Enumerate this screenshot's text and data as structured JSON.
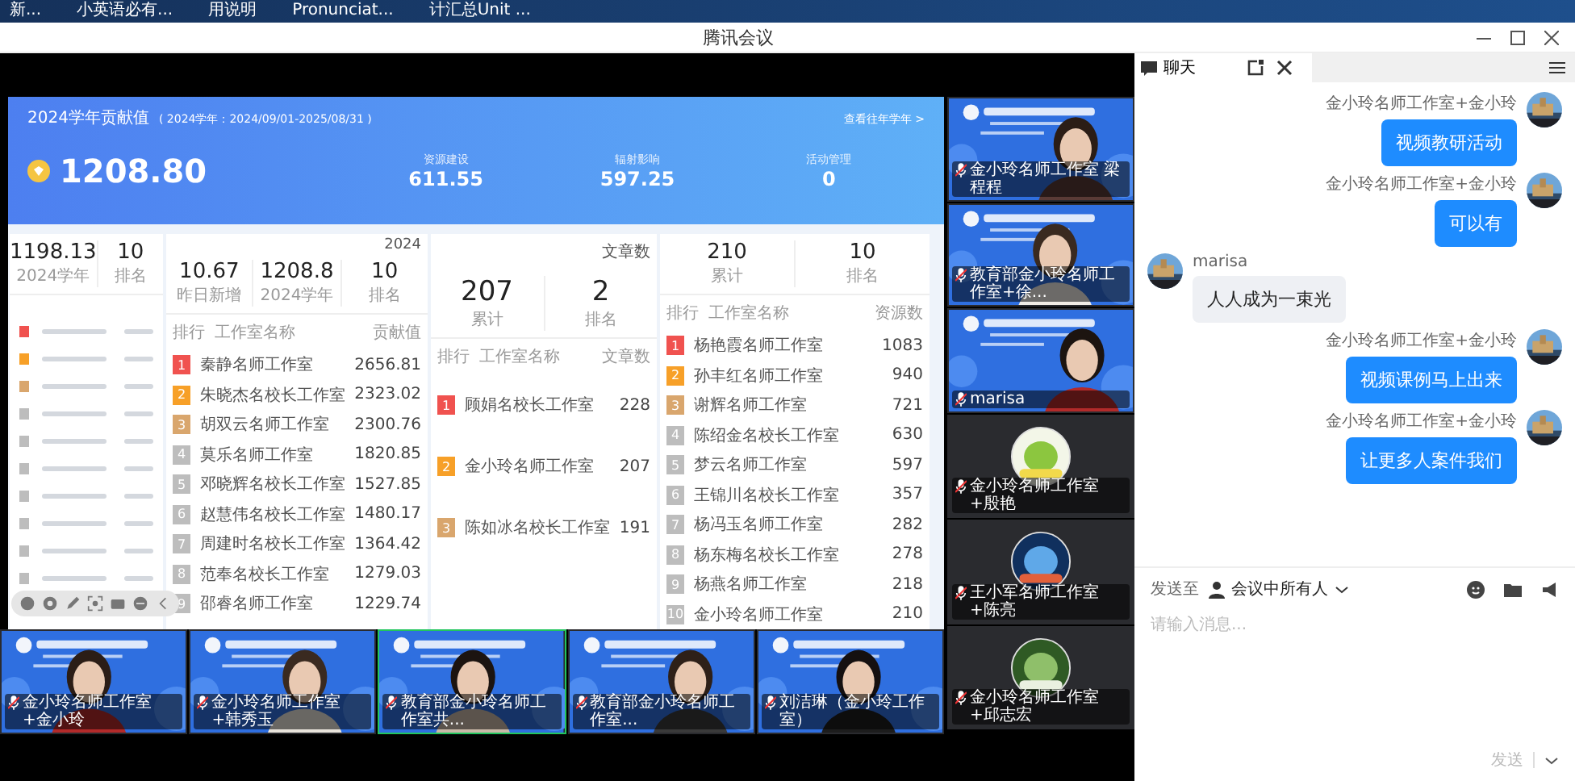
{
  "taskbar": {
    "items": [
      "新...",
      "小英语必有...",
      "用说明",
      "Pronunciat...",
      "计汇总Unit ..."
    ]
  },
  "window": {
    "title": "腾讯会议"
  },
  "share": {
    "header": {
      "title": "2024学年贡献值",
      "period": "( 2024学年：2024/09/01-2025/08/31 )",
      "link": "查看往年学年 >",
      "total": "1208.80",
      "metrics": [
        {
          "label": "资源建设",
          "value": "611.55"
        },
        {
          "label": "辐射影响",
          "value": "597.25"
        },
        {
          "label": "活动管理",
          "value": "0"
        }
      ]
    },
    "card1": {
      "stats": [
        {
          "value": "1198.13",
          "label": "2024学年"
        },
        {
          "value": "10",
          "label": "排名"
        }
      ],
      "rows": [
        {
          "color": "#f0524f"
        },
        {
          "color": "#f7a028"
        },
        {
          "color": "#d9a66d"
        },
        {
          "color": "#bdbdbd"
        },
        {
          "color": "#bdbdbd"
        },
        {
          "color": "#bdbdbd"
        },
        {
          "color": "#bdbdbd"
        },
        {
          "color": "#bdbdbd"
        },
        {
          "color": "#bdbdbd"
        },
        {
          "color": "#bdbdbd"
        }
      ]
    },
    "card2": {
      "year": "2024",
      "stats": [
        {
          "value": "10.67",
          "label": "昨日新增"
        },
        {
          "value": "1208.8",
          "label": "2024学年"
        },
        {
          "value": "10",
          "label": "排名"
        }
      ],
      "columns": [
        "排行",
        "工作室名称",
        "贡献值"
      ],
      "rows": [
        {
          "rank": "1",
          "color": "#f0524f",
          "name": "秦静名师工作室",
          "value": "2656.81"
        },
        {
          "rank": "2",
          "color": "#f7a028",
          "name": "朱晓杰名校长工作室",
          "value": "2323.02"
        },
        {
          "rank": "3",
          "color": "#d9a66d",
          "name": "胡双云名师工作室",
          "value": "2300.76"
        },
        {
          "rank": "4",
          "color": "#bdbdbd",
          "name": "莫乐名师工作室",
          "value": "1820.85"
        },
        {
          "rank": "5",
          "color": "#bdbdbd",
          "name": "邓晓辉名校长工作室",
          "value": "1527.85"
        },
        {
          "rank": "6",
          "color": "#bdbdbd",
          "name": "赵慧伟名校长工作室",
          "value": "1480.17"
        },
        {
          "rank": "7",
          "color": "#bdbdbd",
          "name": "周建时名校长工作室",
          "value": "1364.42"
        },
        {
          "rank": "8",
          "color": "#bdbdbd",
          "name": "范奉名校长工作室",
          "value": "1279.03"
        },
        {
          "rank": "9",
          "color": "#bdbdbd",
          "name": "邵睿名师工作室",
          "value": "1229.74"
        }
      ]
    },
    "card3": {
      "title": "文章数",
      "stats": [
        {
          "value": "207",
          "label": "累计"
        },
        {
          "value": "2",
          "label": "排名"
        }
      ],
      "columns": [
        "排行",
        "工作室名称",
        "文章数"
      ],
      "rows": [
        {
          "rank": "1",
          "color": "#f0524f",
          "name": "顾娟名校长工作室",
          "value": "228"
        },
        {
          "rank": "2",
          "color": "#f7a028",
          "name": "金小玲名师工作室",
          "value": "207"
        },
        {
          "rank": "3",
          "color": "#d9a66d",
          "name": "陈如冰名校长工作室",
          "value": "191"
        }
      ]
    },
    "card4": {
      "stats": [
        {
          "value": "210",
          "label": "累计"
        },
        {
          "value": "10",
          "label": "排名"
        }
      ],
      "columns": [
        "排行",
        "工作室名称",
        "资源数"
      ],
      "rows": [
        {
          "rank": "1",
          "color": "#f0524f",
          "name": "杨艳霞名师工作室",
          "value": "1083"
        },
        {
          "rank": "2",
          "color": "#f7a028",
          "name": "孙丰红名师工作室",
          "value": "940"
        },
        {
          "rank": "3",
          "color": "#d9a66d",
          "name": "谢辉名师工作室",
          "value": "721"
        },
        {
          "rank": "4",
          "color": "#bdbdbd",
          "name": "陈绍金名校长工作室",
          "value": "630"
        },
        {
          "rank": "5",
          "color": "#bdbdbd",
          "name": "梦云名师工作室",
          "value": "597"
        },
        {
          "rank": "6",
          "color": "#bdbdbd",
          "name": "王锦川名校长工作室",
          "value": "357"
        },
        {
          "rank": "7",
          "color": "#bdbdbd",
          "name": "杨冯玉名师工作室",
          "value": "282"
        },
        {
          "rank": "8",
          "color": "#bdbdbd",
          "name": "杨东梅名校长工作室",
          "value": "278"
        },
        {
          "rank": "9",
          "color": "#bdbdbd",
          "name": "杨燕名师工作室",
          "value": "218"
        },
        {
          "rank": "10",
          "color": "#bdbdbd",
          "name": "金小玲名师工作室",
          "value": "210"
        }
      ]
    }
  },
  "video_strip": [
    {
      "kind": "video",
      "name": "金小玲名师工作室+金小玲",
      "selected": false
    },
    {
      "kind": "video",
      "name": "金小玲名师工作室+韩秀玉",
      "selected": false
    },
    {
      "kind": "video",
      "name": "教育部金小玲名师工作室共...",
      "selected": true
    },
    {
      "kind": "video",
      "name": "教育部金小玲名师工作室...",
      "selected": false
    },
    {
      "kind": "video",
      "name": "刘洁琳（金小玲工作室）",
      "selected": false
    }
  ],
  "video_column": [
    {
      "kind": "video",
      "name": "金小玲名师工作室 梁程程"
    },
    {
      "kind": "video",
      "name": "教育部金小玲名师工作室+徐..."
    },
    {
      "kind": "video",
      "name": "marisa"
    },
    {
      "kind": "avatar",
      "name": "金小玲名师工作室+殷艳"
    },
    {
      "kind": "avatar",
      "name": "王小军名师工作室+陈亮"
    },
    {
      "kind": "avatar",
      "name": "金小玲名师工作室+邱志宏"
    }
  ],
  "chat": {
    "tab": "聊天",
    "messages": [
      {
        "kind": "self",
        "sender": "金小玲名师工作室+金小玲",
        "text": "视频教研活动"
      },
      {
        "kind": "self",
        "sender": "金小玲名师工作室+金小玲",
        "text": "可以有"
      },
      {
        "kind": "other",
        "sender": "marisa",
        "text": "人人成为一束光"
      },
      {
        "kind": "self",
        "sender": "金小玲名师工作室+金小玲",
        "text": "视频课例马上出来"
      },
      {
        "kind": "self",
        "sender": "金小玲名师工作室+金小玲",
        "text": "让更多人案件我们"
      }
    ],
    "send_to_label": "发送至",
    "recipient": "会议中所有人",
    "placeholder": "请输入消息...",
    "send": "发送"
  }
}
